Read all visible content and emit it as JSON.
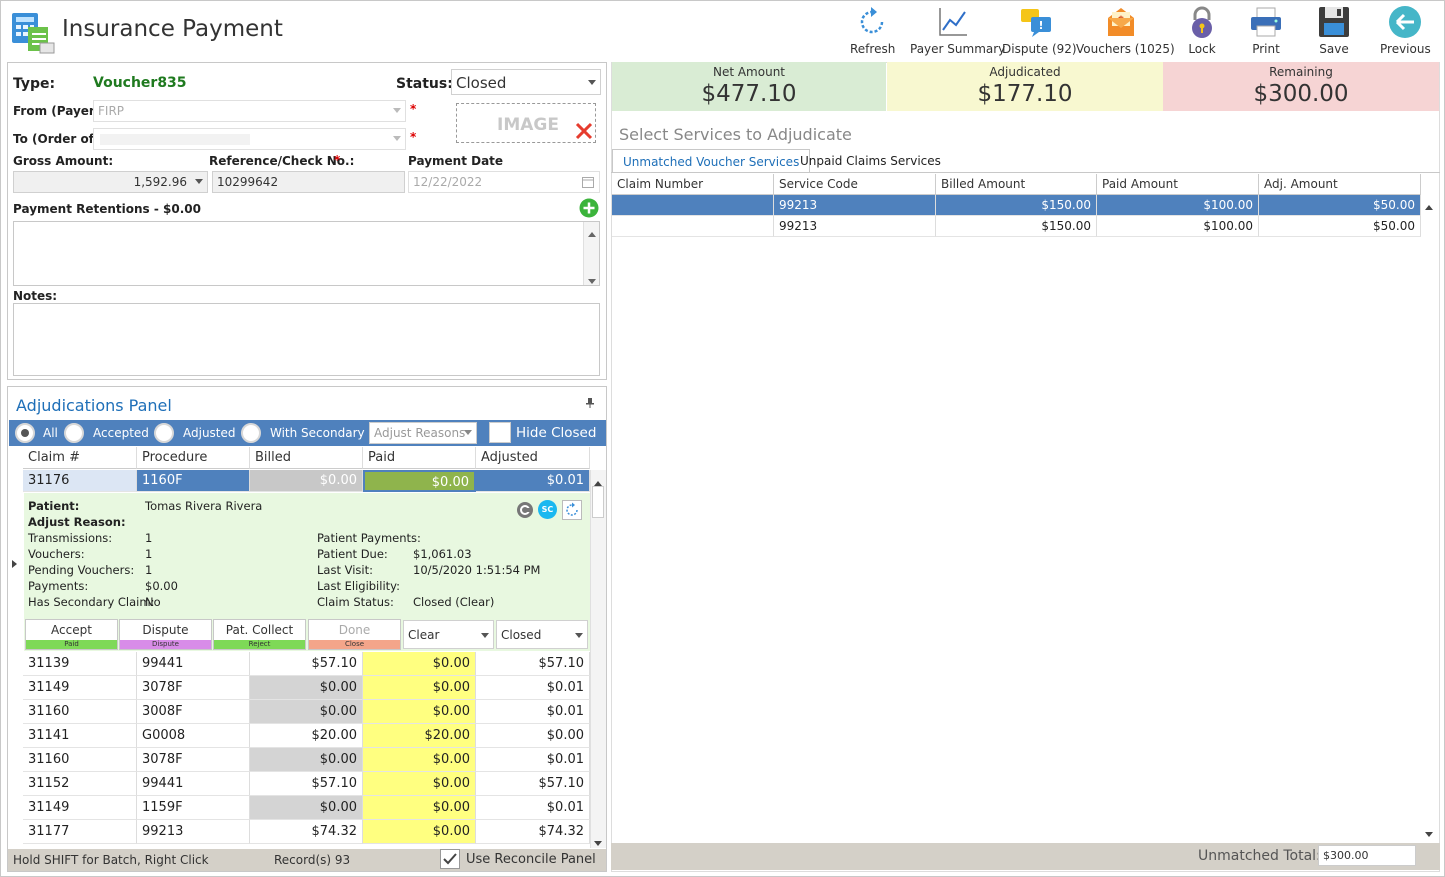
{
  "app": {
    "title": "Insurance Payment"
  },
  "toolbar": [
    {
      "label": "Refresh",
      "icon": "refresh-icon"
    },
    {
      "label": "Payer Summary",
      "icon": "chart-line-icon"
    },
    {
      "label": "Dispute (92)",
      "icon": "dispute-icon"
    },
    {
      "label": "Vouchers (1025)",
      "icon": "voucher-icon"
    },
    {
      "label": "Lock",
      "icon": "lock-icon"
    },
    {
      "label": "Print",
      "icon": "printer-icon"
    },
    {
      "label": "Save",
      "icon": "save-icon"
    },
    {
      "label": "Previous",
      "icon": "arrow-left-icon"
    }
  ],
  "form": {
    "type_label": "Type:",
    "type_value": "Voucher835",
    "status_label": "Status:",
    "status_value": "Closed",
    "from_label": "From (Payer):",
    "from_value": "FIRP",
    "to_label": "To (Order of):",
    "to_value": "",
    "image_label": "IMAGE",
    "gross_label": "Gross Amount:",
    "gross_value": "1,592.96",
    "ref_label": "Reference/Check No.:",
    "ref_value": "10299642",
    "date_label": "Payment Date",
    "date_value": "12/22/2022",
    "retentions_label": "Payment Retentions - $0.00",
    "notes_label": "Notes:",
    "required_mark": "*"
  },
  "adjudications": {
    "title": "Adjudications Panel",
    "filters": [
      "All",
      "Accepted",
      "Adjusted",
      "With Secondary"
    ],
    "adjust_reasons_placeholder": "Adjust Reasons",
    "hide_closed_label": "Hide Closed",
    "columns": [
      "Claim #",
      "Procedure",
      "Billed",
      "Paid",
      "Adjusted"
    ],
    "selected_row": {
      "claim": "31176",
      "procedure": "1160F",
      "billed": "$0.00",
      "paid": "$0.00",
      "adjusted": "$0.01"
    },
    "detail": {
      "patient_label": "Patient:",
      "patient_value": "Tomas Rivera Rivera",
      "adjust_reason_label": "Adjust Reason:",
      "transmissions_label": "Transmissions:",
      "transmissions_value": "1",
      "vouchers_label": "Vouchers:",
      "vouchers_value": "1",
      "pending_label": "Pending Vouchers:",
      "pending_value": "1",
      "payments_label": "Payments:",
      "payments_value": "$0.00",
      "secondary_label": "Has Secondary Claim:",
      "secondary_value": "No",
      "pat_payments_label": "Patient Payments:",
      "pat_payments_value": "",
      "pat_due_label": "Patient Due:",
      "pat_due_value": "$1,061.03",
      "last_visit_label": "Last Visit:",
      "last_visit_value": "10/5/2020 1:51:54 PM",
      "last_elig_label": "Last Eligibility:",
      "last_elig_value": "",
      "claim_status_label": "Claim Status:",
      "claim_status_value": "Closed  (Clear)",
      "sc_badge": "SC"
    },
    "actions": [
      {
        "label": "Accept",
        "sub": "Paid",
        "color": "#7ed957"
      },
      {
        "label": "Dispute",
        "sub": "Dispute",
        "color": "#d88ce8"
      },
      {
        "label": "Pat. Collect",
        "sub": "Reject",
        "color": "#7ed957"
      },
      {
        "label": "Done",
        "sub": "Close",
        "color": "#f4a58a"
      }
    ],
    "clear_value": "Clear",
    "closed_value": "Closed",
    "rows": [
      {
        "claim": "31139",
        "procedure": "99441",
        "billed": "$57.10",
        "paid": "$0.00",
        "adjusted": "$57.10",
        "billed_gray": false
      },
      {
        "claim": "31149",
        "procedure": "3078F",
        "billed": "$0.00",
        "paid": "$0.00",
        "adjusted": "$0.01",
        "billed_gray": true
      },
      {
        "claim": "31160",
        "procedure": "3008F",
        "billed": "$0.00",
        "paid": "$0.00",
        "adjusted": "$0.01",
        "billed_gray": true
      },
      {
        "claim": "31141",
        "procedure": "G0008",
        "billed": "$20.00",
        "paid": "$20.00",
        "adjusted": "$0.00",
        "billed_gray": false
      },
      {
        "claim": "31160",
        "procedure": "3078F",
        "billed": "$0.00",
        "paid": "$0.00",
        "adjusted": "$0.01",
        "billed_gray": true
      },
      {
        "claim": "31152",
        "procedure": "99441",
        "billed": "$57.10",
        "paid": "$0.00",
        "adjusted": "$57.10",
        "billed_gray": false
      },
      {
        "claim": "31149",
        "procedure": "1159F",
        "billed": "$0.00",
        "paid": "$0.00",
        "adjusted": "$0.01",
        "billed_gray": true
      },
      {
        "claim": "31177",
        "procedure": "99213",
        "billed": "$74.32",
        "paid": "$0.00",
        "adjusted": "$74.32",
        "billed_gray": false
      }
    ],
    "status_hint": "Hold SHIFT for Batch, Right Click",
    "records": "Record(s) 93",
    "reconcile_label": "Use Reconcile Panel"
  },
  "summary": [
    {
      "caption": "Net Amount",
      "value": "$477.10",
      "color": "#d9ecd4"
    },
    {
      "caption": "Adjudicated",
      "value": "$177.10",
      "color": "#f8f8d0"
    },
    {
      "caption": "Remaining",
      "value": "$300.00",
      "color": "#f6d4d4"
    }
  ],
  "services": {
    "title": "Select Services to Adjudicate",
    "tabs": [
      "Unmatched Voucher Services",
      "Unpaid Claims Services"
    ],
    "columns": [
      "Claim Number",
      "Service Code",
      "Billed Amount",
      "Paid Amount",
      "Adj. Amount"
    ],
    "rows": [
      {
        "claim": "",
        "code": "99213",
        "billed": "$150.00",
        "paid": "$100.00",
        "adj": "$50.00"
      },
      {
        "claim": "",
        "code": "99213",
        "billed": "$150.00",
        "paid": "$100.00",
        "adj": "$50.00"
      }
    ],
    "unmatched_total_label": "Unmatched Total:",
    "unmatched_total_value": "$300.00"
  }
}
